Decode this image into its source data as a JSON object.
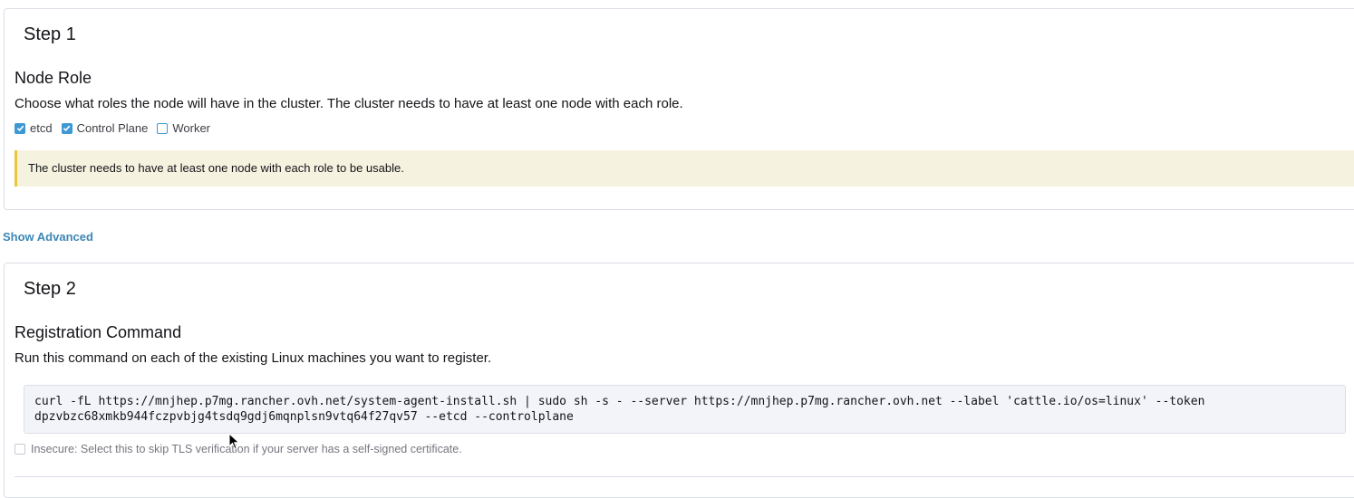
{
  "step1": {
    "title": "Step 1",
    "node_role_heading": "Node Role",
    "description": "Choose what roles the node will have in the cluster. The cluster needs to have at least one node with each role.",
    "roles": [
      {
        "label": "etcd",
        "checked": true
      },
      {
        "label": "Control Plane",
        "checked": true
      },
      {
        "label": "Worker",
        "checked": false
      }
    ],
    "warning": "The cluster needs to have at least one node with each role to be usable."
  },
  "show_advanced": "Show Advanced",
  "step2": {
    "title": "Step 2",
    "heading": "Registration Command",
    "description": "Run this command on each of the existing Linux machines you want to register.",
    "command_line1": "curl -fL https://mnjhep.p7mg.rancher.ovh.net/system-agent-install.sh | sudo sh -s - --server https://mnjhep.p7mg.rancher.ovh.net --label 'cattle.io/os=linux' --token",
    "command_line2": "dpzvbzc68xmkb944fczpvbjg4tsdq9gdj6mqnplsn9vtq64f27qv57 --etcd --controlplane",
    "insecure_label": "Insecure: Select this to skip TLS verification if your server has a self-signed certificate.",
    "insecure_checked": false
  },
  "colors": {
    "accent": "#3d98d3",
    "link": "#3d87b5",
    "warning_bg": "#f6f2e0",
    "warning_border": "#e9c63b"
  }
}
